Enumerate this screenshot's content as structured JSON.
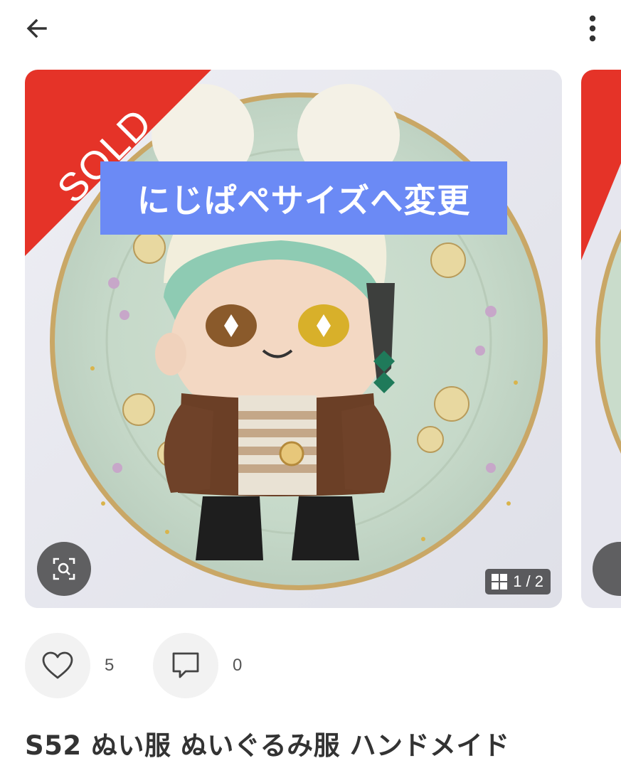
{
  "header": {
    "back_icon": "arrow-left-icon",
    "more_icon": "more-vertical-icon"
  },
  "gallery": {
    "sold_label": "SOLD",
    "banner_text": "にじぱぺサイズへ変更",
    "counter_icon": "grid-icon",
    "counter_text": "1 / 2",
    "zoom_icon": "zoom-scan-icon",
    "accent_color": "#e53328",
    "banner_color": "#6b8af5"
  },
  "actions": {
    "like_icon": "heart-icon",
    "like_count": "5",
    "comment_icon": "comment-icon",
    "comment_count": "0"
  },
  "product": {
    "title": "S52 ぬい服 ぬいぐるみ服 ハンドメイド"
  }
}
